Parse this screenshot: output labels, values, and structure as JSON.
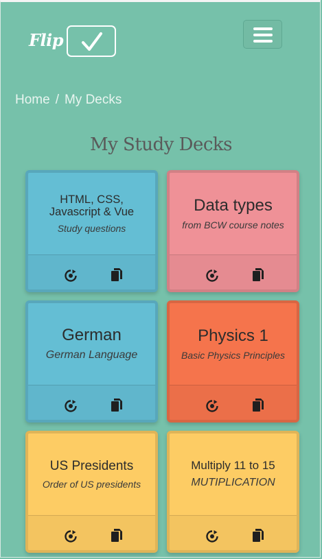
{
  "header": {
    "logo_text": "Flip",
    "menu_icon": "hamburger-icon"
  },
  "breadcrumb": {
    "home": "Home",
    "separator": "/",
    "current": "My Decks"
  },
  "page": {
    "title": "My Study Decks"
  },
  "decks": [
    {
      "title": "HTML, CSS, Javascript & Vue",
      "subtitle": "Study questions",
      "color": "#64bed4"
    },
    {
      "title": "Data types",
      "subtitle": "from BCW course notes",
      "color": "#ef9197"
    },
    {
      "title": "German",
      "subtitle": "German Language",
      "color": "#64bed4"
    },
    {
      "title": "Physics 1",
      "subtitle": "Basic Physics Principles",
      "color": "#f5744c"
    },
    {
      "title": "US Presidents",
      "subtitle": "Order of US presidents",
      "color": "#fdcc64"
    },
    {
      "title": "Multiply 11 to 15",
      "subtitle": "MUTIPLICATION",
      "color": "#fdcc64"
    }
  ],
  "icons": {
    "study": "study-target-icon",
    "cards": "cards-copy-icon"
  }
}
